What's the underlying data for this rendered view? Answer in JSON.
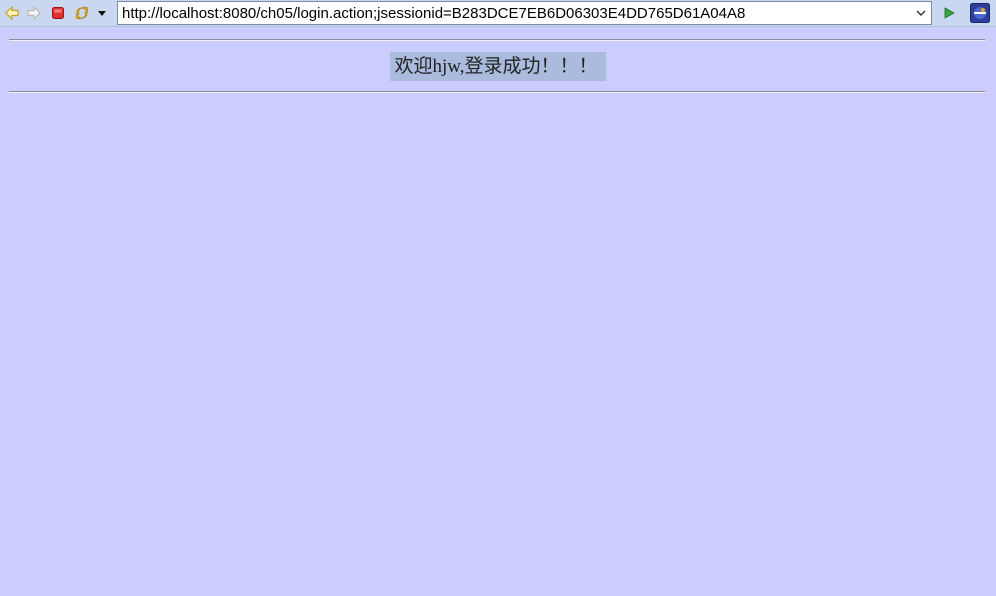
{
  "toolbar": {
    "back_icon": "back-arrow-icon",
    "forward_icon": "forward-arrow-icon",
    "stop_icon": "stop-icon",
    "refresh_icon": "refresh-icon",
    "menu_icon": "dropdown-arrow-icon",
    "url": "http://localhost:8080/ch05/login.action;jsessionid=B283DCE7EB6D06303E4DD765D61A04A8",
    "go_icon": "go-play-icon",
    "app_icon": "eclipse-icon"
  },
  "page": {
    "welcome_message": "欢迎hjw,登录成功！！！"
  },
  "colors": {
    "page_background": "#ccccff",
    "message_background": "#aabbdd",
    "toolbar_background": "#c9d8f0"
  }
}
